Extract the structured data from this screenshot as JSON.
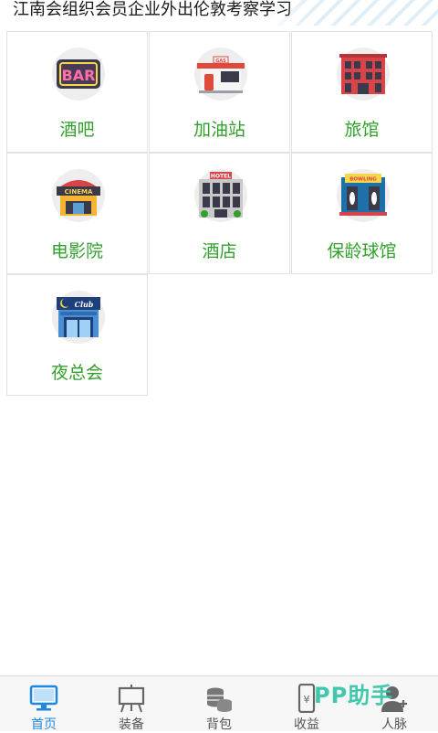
{
  "header": {
    "title": "江南会组织会员企业外出伦敦考察学习"
  },
  "categories": [
    {
      "label": "酒吧",
      "icon": "bar-sign-icon",
      "sign": "BAR"
    },
    {
      "label": "加油站",
      "icon": "gas-station-icon",
      "sign": "GAS"
    },
    {
      "label": "旅馆",
      "icon": "inn-building-icon"
    },
    {
      "label": "电影院",
      "icon": "cinema-icon",
      "sign": "CINEMA"
    },
    {
      "label": "酒店",
      "icon": "hotel-building-icon",
      "sign": "HOTEL"
    },
    {
      "label": "保龄球馆",
      "icon": "bowling-icon",
      "sign": "BOWLING"
    },
    {
      "label": "夜总会",
      "icon": "nightclub-icon",
      "sign": "Club"
    }
  ],
  "tabbar": {
    "tabs": [
      {
        "label": "首页",
        "icon": "monitor-icon",
        "active": true
      },
      {
        "label": "装备",
        "icon": "easel-icon",
        "active": false
      },
      {
        "label": "背包",
        "icon": "coins-icon",
        "active": false
      },
      {
        "label": "收益",
        "icon": "phone-yuan-icon",
        "active": false
      },
      {
        "label": "人脉",
        "icon": "person-add-icon",
        "active": false
      }
    ]
  },
  "watermark": {
    "text": "PP助手"
  },
  "colors": {
    "label_green": "#33a02c",
    "tab_active": "#1e88e5",
    "tab_inactive": "#555555"
  }
}
